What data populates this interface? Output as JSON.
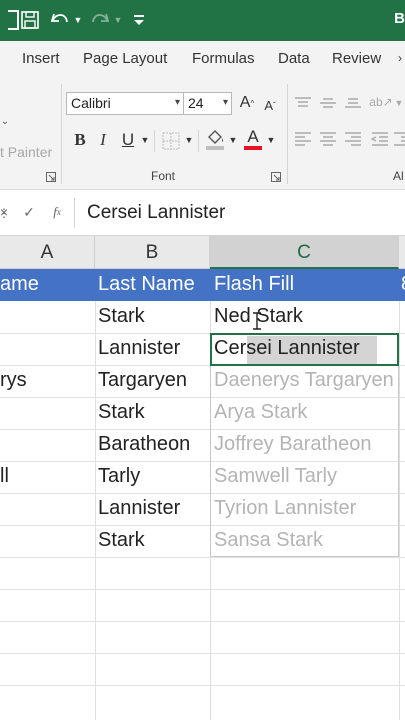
{
  "titlebar": {
    "title_cut": "B",
    "qat": [
      "autosave-icon",
      "save-icon",
      "undo-icon",
      "redo-icon",
      "customize-qat-icon"
    ]
  },
  "tabs": [
    "Insert",
    "Page Layout",
    "Formulas",
    "Data",
    "Review"
  ],
  "ribbon": {
    "format_painter": "t Painter",
    "font_name": "Calibri",
    "font_size": "24",
    "group_font_label": "Font",
    "group_cut_label": "Al"
  },
  "formula_bar": {
    "content": "Cersei Lannister"
  },
  "columns": [
    {
      "letter": "A"
    },
    {
      "letter": "B"
    },
    {
      "letter": "C"
    }
  ],
  "header_row": {
    "a": "ame",
    "b": "Last Name",
    "c": "Flash Fill",
    "d": "8"
  },
  "rows": [
    {
      "a": "",
      "b": " Stark",
      "c": "Ned Stark",
      "suggested": false
    },
    {
      "a": "",
      "b": "Lannister",
      "c": "Cersei Lannister",
      "suggested": false
    },
    {
      "a": "rys",
      "b": " Targaryen",
      "c": "Daenerys Targaryen",
      "suggested": true
    },
    {
      "a": "",
      "b": "Stark",
      "c": "Arya Stark",
      "suggested": true
    },
    {
      "a": "",
      "b": "Baratheon",
      "c": "Joffrey Baratheon",
      "suggested": true
    },
    {
      "a": "ll",
      "b": "Tarly",
      "c": "Samwell Tarly",
      "suggested": true
    },
    {
      "a": "",
      "b": "Lannister",
      "c": "Tyrion Lannister",
      "suggested": true
    },
    {
      "a": "",
      "b": "Stark",
      "c": "Sansa Stark",
      "suggested": true
    }
  ],
  "colors": {
    "excel_green": "#217346",
    "table_header_blue": "#4472c4",
    "flash_fill_suggestion": "#b4b4b4"
  }
}
